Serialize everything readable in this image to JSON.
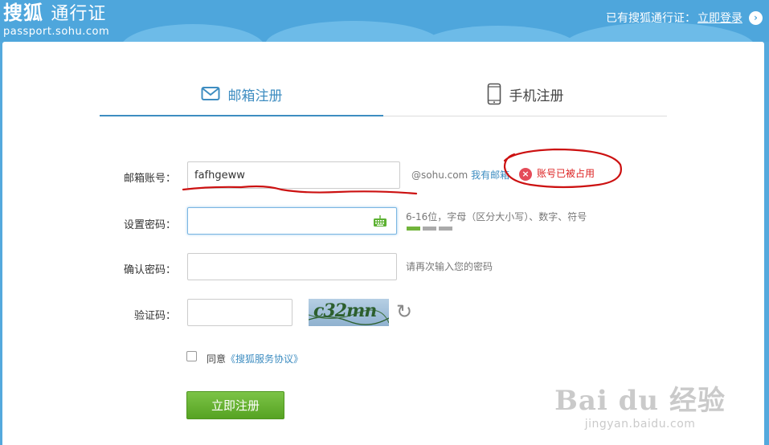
{
  "header": {
    "logo_main": "搜狐",
    "logo_sub": "通行证",
    "logo_url": "passport.sohu.com",
    "prompt": "已有搜狐通行证：",
    "login_link": "立即登录",
    "arrow_icon": "›"
  },
  "tabs": [
    {
      "label": "邮箱注册",
      "icon": "mail-icon",
      "active": true
    },
    {
      "label": "手机注册",
      "icon": "phone-icon",
      "active": false
    }
  ],
  "form": {
    "email": {
      "label": "邮箱账号：",
      "value": "fafhgeww",
      "suffix": "@sohu.com",
      "suffix_link": "我有邮箱",
      "error_icon": "×",
      "error": "账号已被占用"
    },
    "password": {
      "label": "设置密码：",
      "hint": "6-16位，字母（区分大小写）、数字、符号",
      "strength_level": 1,
      "strength_total": 3
    },
    "confirm": {
      "label": "确认密码：",
      "hint": "请再次输入您的密码"
    },
    "captcha": {
      "label": "验证码：",
      "image_text": "c32mn",
      "refresh_icon": "↻"
    },
    "agree": {
      "text": "同意",
      "link": "《搜狐服务协议》"
    },
    "submit_label": "立即注册"
  },
  "watermark": {
    "main": "Bai du 经验",
    "sub": "jingyan.baidu.com"
  },
  "colors": {
    "header_blue": "#4ea6dc",
    "accent_blue": "#3e8dc1",
    "error_red": "#e44b59",
    "button_green": "#62ad2c",
    "annotation_red": "#cc1111"
  }
}
